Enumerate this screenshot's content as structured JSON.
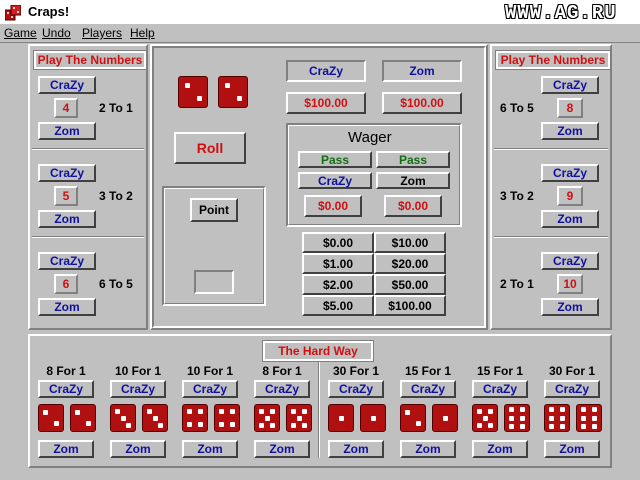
{
  "window": {
    "title": "Craps!",
    "watermark": "WWW.AG.RU"
  },
  "menu": [
    "Game",
    "Undo",
    "Players",
    "Help"
  ],
  "players": {
    "p1": "CraZy",
    "p2": "Zom"
  },
  "balances": {
    "p1": "$100.00",
    "p2": "$100.00"
  },
  "numbers_title": "Play The Numbers",
  "left_numbers": [
    {
      "number": "4",
      "odds": "2 To 1"
    },
    {
      "number": "5",
      "odds": "3 To 2"
    },
    {
      "number": "6",
      "odds": "6 To 5"
    }
  ],
  "right_numbers": [
    {
      "number": "8",
      "odds": "6 To 5"
    },
    {
      "number": "9",
      "odds": "3 To 2"
    },
    {
      "number": "10",
      "odds": "2 To 1"
    }
  ],
  "roll_label": "Roll",
  "point_label": "Point",
  "point_value": "",
  "wager": {
    "title": "Wager",
    "pass_label": "Pass",
    "p1_wager": "$0.00",
    "p2_wager": "$0.00"
  },
  "chips": [
    [
      "$0.00",
      "$10.00"
    ],
    [
      "$1.00",
      "$20.00"
    ],
    [
      "$2.00",
      "$50.00"
    ],
    [
      "$5.00",
      "$100.00"
    ]
  ],
  "hard_way": {
    "title": "The Hard Way",
    "bets": [
      {
        "odds": "8 For 1",
        "dice": [
          2,
          2
        ]
      },
      {
        "odds": "10 For 1",
        "dice": [
          3,
          3
        ]
      },
      {
        "odds": "10 For 1",
        "dice": [
          4,
          4
        ]
      },
      {
        "odds": "8 For 1",
        "dice": [
          5,
          5
        ]
      },
      {
        "odds": "30 For 1",
        "dice": [
          1,
          1
        ]
      },
      {
        "odds": "15 For 1",
        "dice": [
          2,
          1
        ]
      },
      {
        "odds": "15 For 1",
        "dice": [
          5,
          6
        ]
      },
      {
        "odds": "30 For 1",
        "dice": [
          6,
          6
        ]
      }
    ]
  },
  "top_dice": [
    2,
    2
  ],
  "colors": {
    "die": "#b01010",
    "accent_red": "#d01010",
    "accent_blue": "#1010a0",
    "pass_green": "#107010"
  }
}
